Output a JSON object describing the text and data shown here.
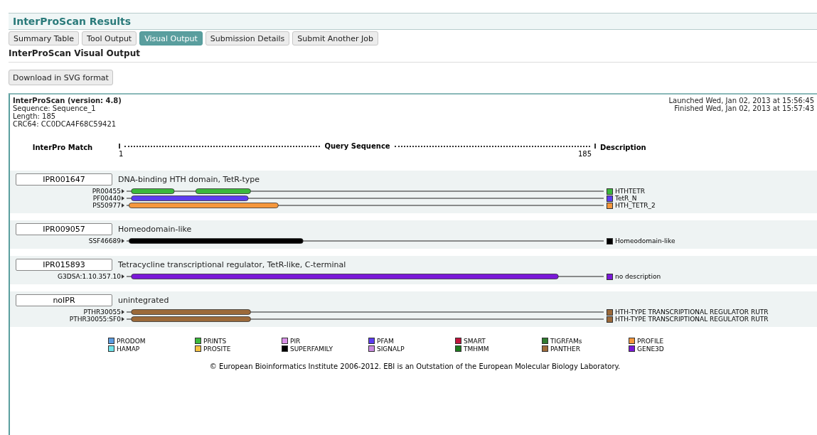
{
  "header": {
    "title": "InterProScan Results"
  },
  "tabs": [
    {
      "label": "Summary Table",
      "selected": false
    },
    {
      "label": "Tool Output",
      "selected": false
    },
    {
      "label": "Visual Output",
      "selected": true
    },
    {
      "label": "Submission Details",
      "selected": false
    },
    {
      "label": "Submit Another Job",
      "selected": false
    }
  ],
  "section_title": "InterProScan Visual Output",
  "download_button": "Download in SVG format",
  "panel": {
    "title": "InterProScan (version: 4.8)",
    "info": [
      "Sequence: Sequence_1",
      "Length: 185",
      "CRC64: CC0DCA4F68C59421"
    ],
    "times": [
      "Launched Wed, Jan 02, 2013 at 15:56:45",
      "Finished Wed, Jan 02, 2013 at 15:57:43"
    ],
    "axis": {
      "left_label": "InterPro Match",
      "center_label": "Query Sequence",
      "start": "1",
      "end": "185",
      "right_label": "Description"
    },
    "groups": [
      {
        "id": "IPR001647",
        "name": "DNA-binding HTH domain, TetR-type",
        "matches": [
          {
            "label": "PR00455",
            "description": "HTHTETR",
            "color": "#3cb83c"
          },
          {
            "label": "PF00440",
            "description": "TetR_N",
            "color": "#5c3cf0"
          },
          {
            "label": "PS50977",
            "description": "HTH_TETR_2",
            "color": "#f5973c"
          }
        ]
      },
      {
        "id": "IPR009057",
        "name": "Homeodomain-like",
        "matches": [
          {
            "label": "SSF46689",
            "description": "Homeodomain-like",
            "color": "#000000"
          }
        ]
      },
      {
        "id": "IPR015893",
        "name": "Tetracycline transcriptional regulator, TetR-like, C-terminal",
        "matches": [
          {
            "label": "G3DSA:1.10.357.10",
            "description": "no description",
            "color": "#7a18d8"
          }
        ]
      },
      {
        "id": "noIPR",
        "name": "unintegrated",
        "matches": [
          {
            "label": "PTHR30055",
            "description": "HTH-TYPE TRANSCRIPTIONAL REGULATOR RUTR",
            "color": "#9c6a3a"
          },
          {
            "label": "PTHR30055:SF0",
            "description": "HTH-TYPE TRANSCRIPTIONAL REGULATOR RUTR",
            "color": "#9c6a3a"
          }
        ]
      }
    ],
    "legend": [
      [
        {
          "label": "PRODOM",
          "color": "#5b9be0"
        },
        {
          "label": "HAMAP",
          "color": "#6fe3ea"
        }
      ],
      [
        {
          "label": "PRINTS",
          "color": "#3cb83c"
        },
        {
          "label": "PROSITE",
          "color": "#f5c242"
        }
      ],
      [
        {
          "label": "PIR",
          "color": "#d88fe6"
        },
        {
          "label": "SUPERFAMILY",
          "color": "#000000"
        }
      ],
      [
        {
          "label": "PFAM",
          "color": "#5c3cf0"
        },
        {
          "label": "SIGNALP",
          "color": "#c98be0"
        }
      ],
      [
        {
          "label": "SMART",
          "color": "#c0143c"
        },
        {
          "label": "TMHMM",
          "color": "#1f7a1f"
        }
      ],
      [
        {
          "label": "TIGRFAMs",
          "color": "#2f7a2f"
        },
        {
          "label": "PANTHER",
          "color": "#9c6a3a"
        }
      ],
      [
        {
          "label": "PROFILE",
          "color": "#f5973c"
        },
        {
          "label": "GENE3D",
          "color": "#7a18d8"
        }
      ]
    ],
    "footer": "© European Bioinformatics Institute 2006-2012. EBI is an Outstation of the European Molecular Biology Laboratory."
  }
}
